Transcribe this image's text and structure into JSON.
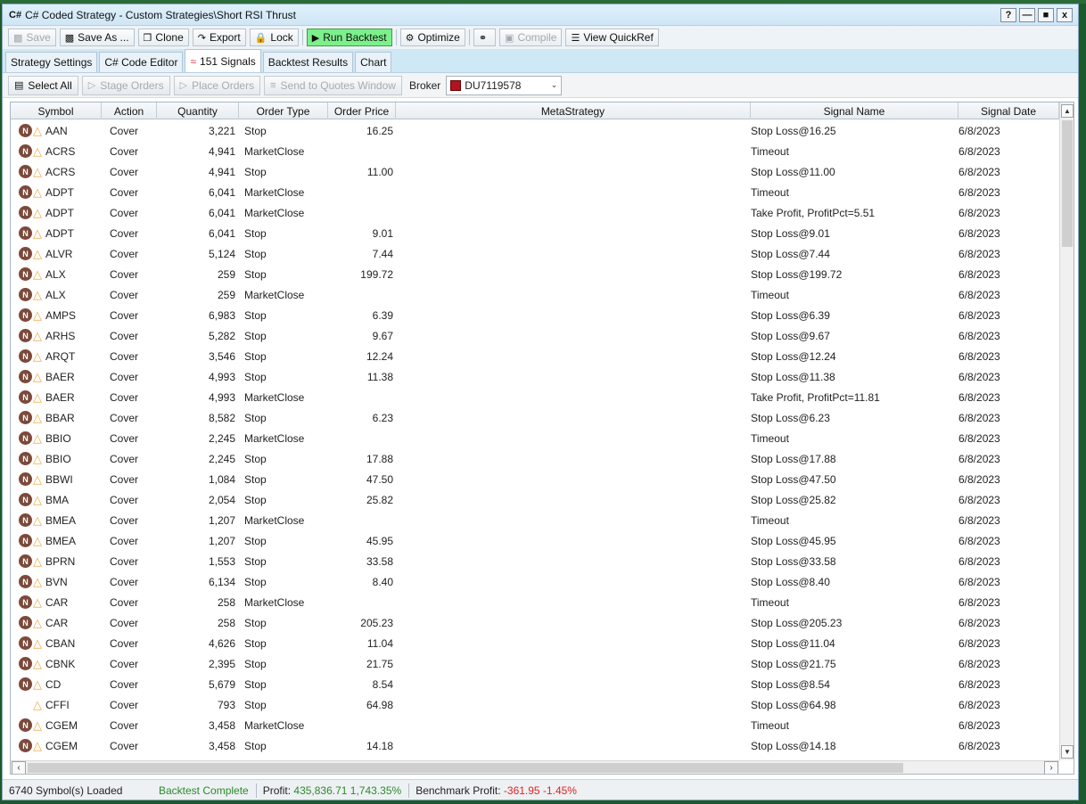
{
  "window": {
    "title_icon": "C#",
    "title": "C# Coded Strategy - Custom Strategies\\Short RSI Thrust",
    "controls": [
      "?",
      "—",
      "■",
      "x"
    ]
  },
  "toolbar": {
    "save": "Save",
    "save_as": "Save As ...",
    "clone": "Clone",
    "export": "Export",
    "lock": "Lock",
    "run_backtest": "Run Backtest",
    "optimize": "Optimize",
    "compile": "Compile",
    "view_quickref": "View QuickRef",
    "run_color": "#7cf08a"
  },
  "tabs": [
    "Strategy Settings",
    "C# Code Editor",
    "151 Signals",
    "Backtest Results",
    "Chart"
  ],
  "actionbar": {
    "select_all": "Select All",
    "stage_orders": "Stage Orders",
    "place_orders": "Place Orders",
    "send_to_quotes": "Send to Quotes Window",
    "broker_label": "Broker",
    "broker_value": "DU7119578"
  },
  "grid": {
    "columns": [
      "Symbol",
      "Action",
      "Quantity",
      "Order Type",
      "Order Price",
      "MetaStrategy",
      "Signal Name",
      "Signal Date"
    ],
    "rows": [
      {
        "n": true,
        "symbol": "AAN",
        "action": "Cover",
        "qty": "3,221",
        "type": "Stop",
        "price": "16.25",
        "signal": "Stop Loss@16.25",
        "date": "6/8/2023"
      },
      {
        "n": true,
        "symbol": "ACRS",
        "action": "Cover",
        "qty": "4,941",
        "type": "MarketClose",
        "price": "",
        "signal": "Timeout",
        "date": "6/8/2023"
      },
      {
        "n": true,
        "symbol": "ACRS",
        "action": "Cover",
        "qty": "4,941",
        "type": "Stop",
        "price": "11.00",
        "signal": "Stop Loss@11.00",
        "date": "6/8/2023"
      },
      {
        "n": true,
        "symbol": "ADPT",
        "action": "Cover",
        "qty": "6,041",
        "type": "MarketClose",
        "price": "",
        "signal": "Timeout",
        "date": "6/8/2023"
      },
      {
        "n": true,
        "symbol": "ADPT",
        "action": "Cover",
        "qty": "6,041",
        "type": "MarketClose",
        "price": "",
        "signal": "Take Profit, ProfitPct=5.51",
        "date": "6/8/2023"
      },
      {
        "n": true,
        "symbol": "ADPT",
        "action": "Cover",
        "qty": "6,041",
        "type": "Stop",
        "price": "9.01",
        "signal": "Stop Loss@9.01",
        "date": "6/8/2023"
      },
      {
        "n": true,
        "symbol": "ALVR",
        "action": "Cover",
        "qty": "5,124",
        "type": "Stop",
        "price": "7.44",
        "signal": "Stop Loss@7.44",
        "date": "6/8/2023"
      },
      {
        "n": true,
        "symbol": "ALX",
        "action": "Cover",
        "qty": "259",
        "type": "Stop",
        "price": "199.72",
        "signal": "Stop Loss@199.72",
        "date": "6/8/2023"
      },
      {
        "n": true,
        "symbol": "ALX",
        "action": "Cover",
        "qty": "259",
        "type": "MarketClose",
        "price": "",
        "signal": "Timeout",
        "date": "6/8/2023"
      },
      {
        "n": true,
        "symbol": "AMPS",
        "action": "Cover",
        "qty": "6,983",
        "type": "Stop",
        "price": "6.39",
        "signal": "Stop Loss@6.39",
        "date": "6/8/2023"
      },
      {
        "n": true,
        "symbol": "ARHS",
        "action": "Cover",
        "qty": "5,282",
        "type": "Stop",
        "price": "9.67",
        "signal": "Stop Loss@9.67",
        "date": "6/8/2023"
      },
      {
        "n": true,
        "symbol": "ARQT",
        "action": "Cover",
        "qty": "3,546",
        "type": "Stop",
        "price": "12.24",
        "signal": "Stop Loss@12.24",
        "date": "6/8/2023"
      },
      {
        "n": true,
        "symbol": "BAER",
        "action": "Cover",
        "qty": "4,993",
        "type": "Stop",
        "price": "11.38",
        "signal": "Stop Loss@11.38",
        "date": "6/8/2023"
      },
      {
        "n": true,
        "symbol": "BAER",
        "action": "Cover",
        "qty": "4,993",
        "type": "MarketClose",
        "price": "",
        "signal": "Take Profit, ProfitPct=11.81",
        "date": "6/8/2023"
      },
      {
        "n": true,
        "symbol": "BBAR",
        "action": "Cover",
        "qty": "8,582",
        "type": "Stop",
        "price": "6.23",
        "signal": "Stop Loss@6.23",
        "date": "6/8/2023"
      },
      {
        "n": true,
        "symbol": "BBIO",
        "action": "Cover",
        "qty": "2,245",
        "type": "MarketClose",
        "price": "",
        "signal": "Timeout",
        "date": "6/8/2023"
      },
      {
        "n": true,
        "symbol": "BBIO",
        "action": "Cover",
        "qty": "2,245",
        "type": "Stop",
        "price": "17.88",
        "signal": "Stop Loss@17.88",
        "date": "6/8/2023"
      },
      {
        "n": true,
        "symbol": "BBWI",
        "action": "Cover",
        "qty": "1,084",
        "type": "Stop",
        "price": "47.50",
        "signal": "Stop Loss@47.50",
        "date": "6/8/2023"
      },
      {
        "n": true,
        "symbol": "BMA",
        "action": "Cover",
        "qty": "2,054",
        "type": "Stop",
        "price": "25.82",
        "signal": "Stop Loss@25.82",
        "date": "6/8/2023"
      },
      {
        "n": true,
        "symbol": "BMEA",
        "action": "Cover",
        "qty": "1,207",
        "type": "MarketClose",
        "price": "",
        "signal": "Timeout",
        "date": "6/8/2023"
      },
      {
        "n": true,
        "symbol": "BMEA",
        "action": "Cover",
        "qty": "1,207",
        "type": "Stop",
        "price": "45.95",
        "signal": "Stop Loss@45.95",
        "date": "6/8/2023"
      },
      {
        "n": true,
        "symbol": "BPRN",
        "action": "Cover",
        "qty": "1,553",
        "type": "Stop",
        "price": "33.58",
        "signal": "Stop Loss@33.58",
        "date": "6/8/2023"
      },
      {
        "n": true,
        "symbol": "BVN",
        "action": "Cover",
        "qty": "6,134",
        "type": "Stop",
        "price": "8.40",
        "signal": "Stop Loss@8.40",
        "date": "6/8/2023"
      },
      {
        "n": true,
        "symbol": "CAR",
        "action": "Cover",
        "qty": "258",
        "type": "MarketClose",
        "price": "",
        "signal": "Timeout",
        "date": "6/8/2023"
      },
      {
        "n": true,
        "symbol": "CAR",
        "action": "Cover",
        "qty": "258",
        "type": "Stop",
        "price": "205.23",
        "signal": "Stop Loss@205.23",
        "date": "6/8/2023"
      },
      {
        "n": true,
        "symbol": "CBAN",
        "action": "Cover",
        "qty": "4,626",
        "type": "Stop",
        "price": "11.04",
        "signal": "Stop Loss@11.04",
        "date": "6/8/2023"
      },
      {
        "n": true,
        "symbol": "CBNK",
        "action": "Cover",
        "qty": "2,395",
        "type": "Stop",
        "price": "21.75",
        "signal": "Stop Loss@21.75",
        "date": "6/8/2023"
      },
      {
        "n": true,
        "symbol": "CD",
        "action": "Cover",
        "qty": "5,679",
        "type": "Stop",
        "price": "8.54",
        "signal": "Stop Loss@8.54",
        "date": "6/8/2023"
      },
      {
        "n": false,
        "symbol": "CFFI",
        "action": "Cover",
        "qty": "793",
        "type": "Stop",
        "price": "64.98",
        "signal": "Stop Loss@64.98",
        "date": "6/8/2023"
      },
      {
        "n": true,
        "symbol": "CGEM",
        "action": "Cover",
        "qty": "3,458",
        "type": "MarketClose",
        "price": "",
        "signal": "Timeout",
        "date": "6/8/2023"
      },
      {
        "n": true,
        "symbol": "CGEM",
        "action": "Cover",
        "qty": "3,458",
        "type": "Stop",
        "price": "14.18",
        "signal": "Stop Loss@14.18",
        "date": "6/8/2023"
      }
    ]
  },
  "status": {
    "loaded": "6740 Symbol(s) Loaded",
    "complete": "Backtest Complete",
    "profit_label": "Profit:",
    "profit_value": "435,836.71 1,743.35%",
    "benchmark_label": "Benchmark Profit:",
    "benchmark_value": "-361.95 -1.45%",
    "positive_color": "#2a8a2a",
    "negative_color": "#e02222"
  }
}
